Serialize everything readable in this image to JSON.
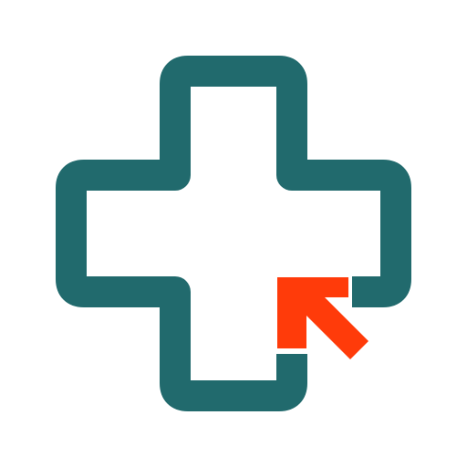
{
  "logo": {
    "icon_name": "medical-cross-cursor-icon",
    "colors": {
      "background": "#ffffff",
      "cross_outline": "#216a6d",
      "cursor": "#ff3b0a"
    }
  }
}
